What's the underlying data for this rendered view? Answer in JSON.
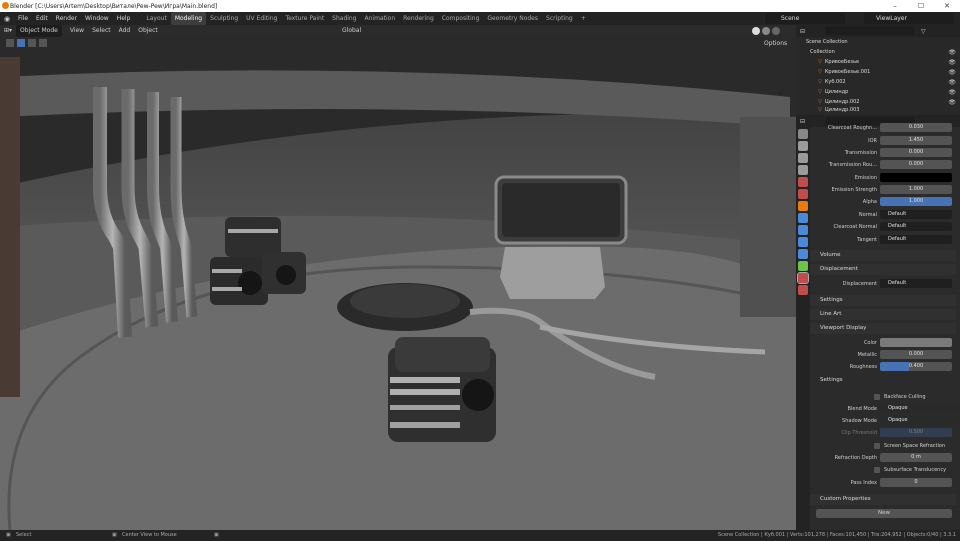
{
  "window": {
    "title": "Blender [C:\\Users\\Artem\\Desktop\\Витале\\Pew-Pew\\Игра\\Main.blend]",
    "min": "–",
    "max": "☐",
    "close": "✕"
  },
  "menu": [
    "File",
    "Edit",
    "Render",
    "Window",
    "Help"
  ],
  "workspaces": [
    "Layout",
    "Modeling",
    "Sculpting",
    "UV Editing",
    "Texture Paint",
    "Shading",
    "Animation",
    "Rendering",
    "Compositing",
    "Geometry Nodes",
    "Scripting"
  ],
  "active_workspace": "Modeling",
  "scene": {
    "label": "Scene",
    "view_layer": "ViewLayer"
  },
  "viewport_header": {
    "mode": "Object Mode",
    "items": [
      "View",
      "Select",
      "Add",
      "Object"
    ],
    "orientation": "Global",
    "options": "Options"
  },
  "outliner": {
    "root": "Scene Collection",
    "collection": "Collection",
    "items": [
      "КривоеБезье",
      "КривоеБезье.001",
      "Куб.002",
      "Цилиндр",
      "Цилиндр.002",
      "Цилиндр.003"
    ]
  },
  "material": {
    "rows": [
      {
        "label": "Clearcoat Roughn...",
        "value": "0.030"
      },
      {
        "label": "IOR",
        "value": "1.450"
      },
      {
        "label": "Transmission",
        "value": "0.000"
      },
      {
        "label": "Transmission Rou...",
        "value": "0.000"
      },
      {
        "label": "Emission",
        "value": ""
      },
      {
        "label": "Emission Strength",
        "value": "1.000"
      },
      {
        "label": "Alpha",
        "value": "1.000"
      },
      {
        "label": "Normal",
        "value": "Default"
      },
      {
        "label": "Clearcoat Normal",
        "value": "Default"
      },
      {
        "label": "Tangent",
        "value": "Default"
      }
    ],
    "volume": "Volume",
    "displacement_section": "Displacement",
    "displacement_label": "Displacement",
    "displacement_value": "Default",
    "settings": "Settings",
    "line_art": "Line Art",
    "viewport_display": "Viewport Display",
    "vd_color": "Color",
    "vd_metallic": "Metallic",
    "vd_metallic_value": "0.000",
    "vd_roughness": "Roughness",
    "vd_roughness_value": "0.400",
    "settings2": "Settings",
    "backface": "Backface Culling",
    "blend_mode": "Blend Mode",
    "blend_value": "Opaque",
    "shadow_mode": "Shadow Mode",
    "shadow_value": "Opaque",
    "clip": "Clip Threshold",
    "clip_value": "0.500",
    "ssr": "Screen Space Refraction",
    "refraction_depth": "Refraction Depth",
    "refraction_value": "0 m",
    "sss": "Subsurface Translucency",
    "pass_index": "Pass Index",
    "pass_value": "0",
    "custom_props": "Custom Properties",
    "new_button": "New"
  },
  "status": {
    "select": "Select",
    "center": "Center View to Mouse",
    "stats": "Scene Collection | Куб.001 | Verts:101,278 | Faces:101,450 | Tris:204,952 | Objects:0/40 | 3.3.1"
  },
  "colors": {
    "accent": "#4772b3",
    "orange": "#e87d0d",
    "green": "#6bc34a"
  }
}
